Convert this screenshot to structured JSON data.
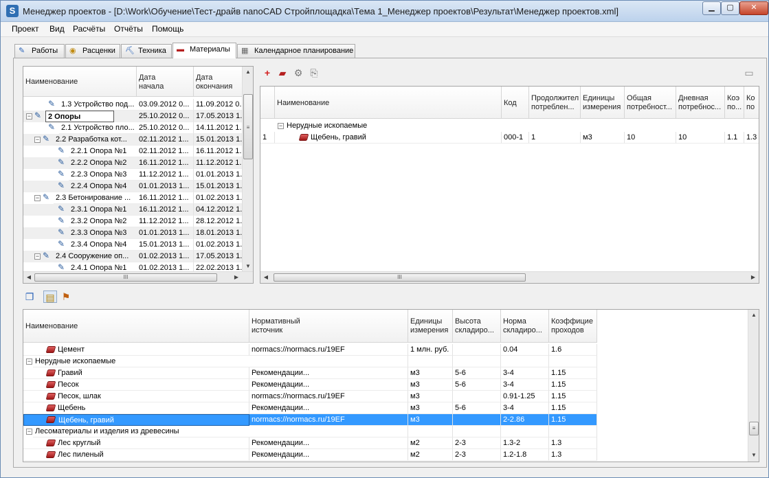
{
  "window": {
    "title": "Менеджер проектов - [D:\\Work\\Обучение\\Тест-драйв nanoCAD Стройплощадка\\Тема 1_Менеджер проектов\\Результат\\Менеджер проектов.xml]",
    "icon_letter": "S"
  },
  "menu": [
    "Проект",
    "Вид",
    "Расчёты",
    "Отчёты",
    "Помощь"
  ],
  "tabs": [
    {
      "label": "Работы",
      "icon": "pencil-icon"
    },
    {
      "label": "Расценки",
      "icon": "coins-icon"
    },
    {
      "label": "Техника",
      "icon": "excavator-icon"
    },
    {
      "label": "Материалы",
      "icon": "bricks-icon",
      "active": true
    },
    {
      "label": "Календарное планирование",
      "icon": "calendar-icon"
    }
  ],
  "tasks": {
    "headers": [
      "Наименование",
      "Дата\nначала",
      "Дата\nокончания"
    ],
    "rows": [
      {
        "level": 2,
        "toggle": "",
        "name": "1.3 Устройство под...",
        "start": "03.09.2012 0...",
        "end": "11.09.2012 0..."
      },
      {
        "level": 0,
        "toggle": "−",
        "name": "2 Опоры",
        "start": "25.10.2012 0...",
        "end": "17.05.2013 1...",
        "bold": true,
        "editing": true
      },
      {
        "level": 2,
        "toggle": "",
        "name": "2.1 Устройство пло...",
        "start": "25.10.2012 0...",
        "end": "14.11.2012 1..."
      },
      {
        "level": 1,
        "toggle": "−",
        "name": "2.2 Разработка кот...",
        "start": "02.11.2012 1...",
        "end": "15.01.2013 1..."
      },
      {
        "level": 3,
        "toggle": "",
        "name": "2.2.1 Опора №1",
        "start": "02.11.2012 1...",
        "end": "16.11.2012 1..."
      },
      {
        "level": 3,
        "toggle": "",
        "name": "2.2.2 Опора №2",
        "start": "16.11.2012 1...",
        "end": "11.12.2012 1..."
      },
      {
        "level": 3,
        "toggle": "",
        "name": "2.2.3 Опора №3",
        "start": "11.12.2012 1...",
        "end": "01.01.2013 1..."
      },
      {
        "level": 3,
        "toggle": "",
        "name": "2.2.4 Опора №4",
        "start": "01.01.2013 1...",
        "end": "15.01.2013 1..."
      },
      {
        "level": 1,
        "toggle": "−",
        "name": "2.3 Бетонирование ...",
        "start": "16.11.2012 1...",
        "end": "01.02.2013 1..."
      },
      {
        "level": 3,
        "toggle": "",
        "name": "2.3.1 Опора №1",
        "start": "16.11.2012 1...",
        "end": "04.12.2012 1..."
      },
      {
        "level": 3,
        "toggle": "",
        "name": "2.3.2 Опора №2",
        "start": "11.12.2012 1...",
        "end": "28.12.2012 1..."
      },
      {
        "level": 3,
        "toggle": "",
        "name": "2.3.3 Опора №3",
        "start": "01.01.2013 1...",
        "end": "18.01.2013 1..."
      },
      {
        "level": 3,
        "toggle": "",
        "name": "2.3.4 Опора №4",
        "start": "15.01.2013 1...",
        "end": "01.02.2013 1..."
      },
      {
        "level": 1,
        "toggle": "−",
        "name": "2.4 Сооружение оп...",
        "start": "01.02.2013 1...",
        "end": "17.05.2013 1..."
      },
      {
        "level": 3,
        "toggle": "",
        "name": "2.4.1 Опора №1",
        "start": "01.02.2013 1...",
        "end": "22.02.2013 1..."
      }
    ]
  },
  "assigned": {
    "headers": [
      "",
      "Наименование",
      "Код",
      "Продолжител\nпотреблен...",
      "Единицы\nизмерения",
      "Общая\nпотребност...",
      "Дневная\nпотребнос...",
      "Коэ\nпо...",
      "Ко\nпо"
    ],
    "group": "Нерудные ископаемые",
    "rows": [
      {
        "num": "1",
        "name": "Щебень, гравий",
        "code": "000-1",
        "duration": "1",
        "unit": "м3",
        "total": "10",
        "daily": "10",
        "k1": "1.1",
        "k2": "1.3"
      }
    ]
  },
  "catalog": {
    "headers": [
      "Наименование",
      "Нормативный\nисточник",
      "Единицы\nизмерения",
      "Высота\nскладиро...",
      "Норма\nскладиро...",
      "Коэффицие\nпроходов"
    ],
    "rows": [
      {
        "type": "item",
        "name": "Цемент",
        "source": "normacs://normacs.ru/19EF",
        "unit": "1 млн. руб.",
        "height": "",
        "norm": "0.04",
        "coef": "1.6"
      },
      {
        "type": "group",
        "name": "Нерудные ископаемые"
      },
      {
        "type": "item",
        "name": "Гравий",
        "source": "Рекомендации...",
        "unit": "м3",
        "height": "5-6",
        "norm": "3-4",
        "coef": "1.15"
      },
      {
        "type": "item",
        "name": "Песок",
        "source": "Рекомендации...",
        "unit": "м3",
        "height": "5-6",
        "norm": "3-4",
        "coef": "1.15"
      },
      {
        "type": "item",
        "name": "Песок, шлак",
        "source": "normacs://normacs.ru/19EF",
        "unit": "м3",
        "height": "",
        "norm": "0.91-1.25",
        "coef": "1.15"
      },
      {
        "type": "item",
        "name": "Щебень",
        "source": "Рекомендации...",
        "unit": "м3",
        "height": "5-6",
        "norm": "3-4",
        "coef": "1.15"
      },
      {
        "type": "item",
        "name": "Щебень, гравий",
        "source": "normacs://normacs.ru/19EF",
        "unit": "м3",
        "height": "",
        "norm": "2-2.86",
        "coef": "1.15",
        "selected": true
      },
      {
        "type": "group",
        "name": "Лесоматериалы и изделия из древесины"
      },
      {
        "type": "item",
        "name": "Лес круглый",
        "source": "Рекомендации...",
        "unit": "м2",
        "height": "2-3",
        "norm": "1.3-2",
        "coef": "1.3"
      },
      {
        "type": "item",
        "name": "Лес пиленый",
        "source": "Рекомендации...",
        "unit": "м2",
        "height": "2-3",
        "norm": "1.2-1.8",
        "coef": "1.3"
      }
    ]
  },
  "colors": {
    "selection": "#3399ff",
    "alt_row": "#efefef",
    "add_icon": "#d42020"
  }
}
